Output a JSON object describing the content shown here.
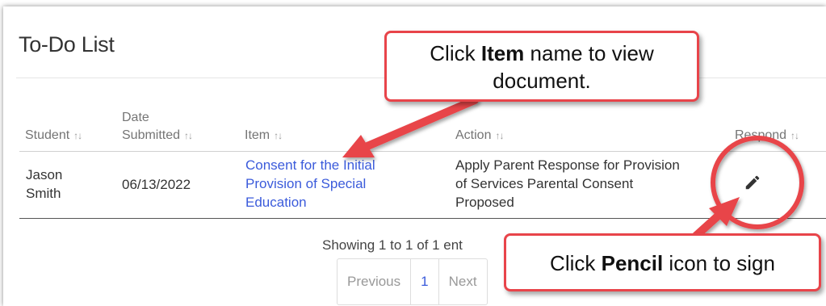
{
  "page": {
    "title": "To-Do List"
  },
  "table": {
    "headers": {
      "student": "Student",
      "date_line1": "Date",
      "date_line2": "Submitted",
      "item": "Item",
      "action": "Action",
      "respond": "Respond"
    },
    "sort_glyph": "↑↓",
    "rows": [
      {
        "student_line1": "Jason",
        "student_line2": "Smith",
        "date": "06/13/2022",
        "item_line1": "Consent for the Initial",
        "item_line2": "Provision of Special",
        "item_line3": "Education",
        "action_line1": "Apply Parent Response for Provision",
        "action_line2": "of Services Parental Consent",
        "action_line3": "Proposed",
        "respond_icon": "pencil-icon"
      }
    ]
  },
  "footer": {
    "showing": "Showing 1 to 1 of 1 ent",
    "pagination": {
      "previous": "Previous",
      "page": "1",
      "next": "Next"
    }
  },
  "callouts": {
    "item_bold": "Item",
    "item_pre": "Click ",
    "item_post": " name to view",
    "item_line2": "document.",
    "pencil_pre": "Click ",
    "pencil_bold": "Pencil",
    "pencil_post": " icon to sign"
  },
  "colors": {
    "link": "#3b5bdb",
    "callout_border": "#e8444a",
    "arrow": "#e8444a"
  }
}
